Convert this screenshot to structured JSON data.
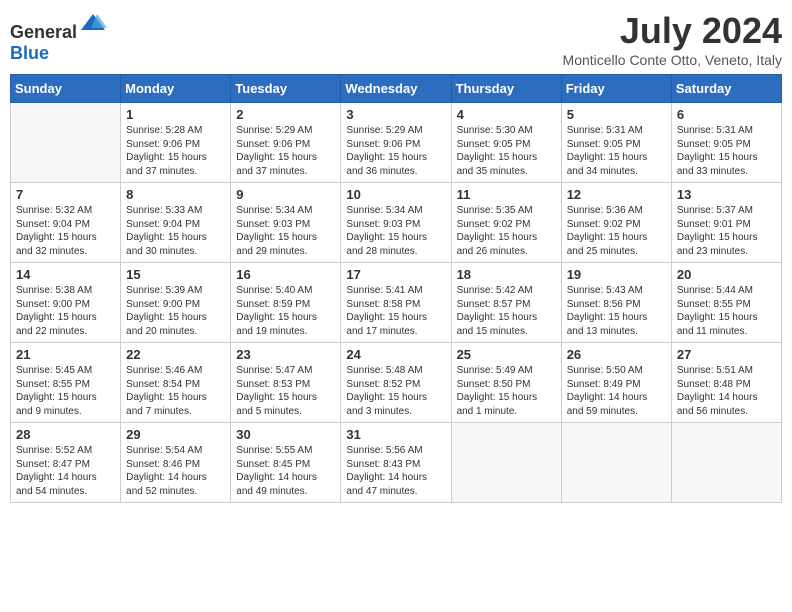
{
  "header": {
    "logo": {
      "general": "General",
      "blue": "Blue"
    },
    "month_year": "July 2024",
    "location": "Monticello Conte Otto, Veneto, Italy"
  },
  "weekdays": [
    "Sunday",
    "Monday",
    "Tuesday",
    "Wednesday",
    "Thursday",
    "Friday",
    "Saturday"
  ],
  "weeks": [
    [
      {
        "day": "",
        "content": ""
      },
      {
        "day": "1",
        "content": "Sunrise: 5:28 AM\nSunset: 9:06 PM\nDaylight: 15 hours\nand 37 minutes."
      },
      {
        "day": "2",
        "content": "Sunrise: 5:29 AM\nSunset: 9:06 PM\nDaylight: 15 hours\nand 37 minutes."
      },
      {
        "day": "3",
        "content": "Sunrise: 5:29 AM\nSunset: 9:06 PM\nDaylight: 15 hours\nand 36 minutes."
      },
      {
        "day": "4",
        "content": "Sunrise: 5:30 AM\nSunset: 9:05 PM\nDaylight: 15 hours\nand 35 minutes."
      },
      {
        "day": "5",
        "content": "Sunrise: 5:31 AM\nSunset: 9:05 PM\nDaylight: 15 hours\nand 34 minutes."
      },
      {
        "day": "6",
        "content": "Sunrise: 5:31 AM\nSunset: 9:05 PM\nDaylight: 15 hours\nand 33 minutes."
      }
    ],
    [
      {
        "day": "7",
        "content": "Sunrise: 5:32 AM\nSunset: 9:04 PM\nDaylight: 15 hours\nand 32 minutes."
      },
      {
        "day": "8",
        "content": "Sunrise: 5:33 AM\nSunset: 9:04 PM\nDaylight: 15 hours\nand 30 minutes."
      },
      {
        "day": "9",
        "content": "Sunrise: 5:34 AM\nSunset: 9:03 PM\nDaylight: 15 hours\nand 29 minutes."
      },
      {
        "day": "10",
        "content": "Sunrise: 5:34 AM\nSunset: 9:03 PM\nDaylight: 15 hours\nand 28 minutes."
      },
      {
        "day": "11",
        "content": "Sunrise: 5:35 AM\nSunset: 9:02 PM\nDaylight: 15 hours\nand 26 minutes."
      },
      {
        "day": "12",
        "content": "Sunrise: 5:36 AM\nSunset: 9:02 PM\nDaylight: 15 hours\nand 25 minutes."
      },
      {
        "day": "13",
        "content": "Sunrise: 5:37 AM\nSunset: 9:01 PM\nDaylight: 15 hours\nand 23 minutes."
      }
    ],
    [
      {
        "day": "14",
        "content": "Sunrise: 5:38 AM\nSunset: 9:00 PM\nDaylight: 15 hours\nand 22 minutes."
      },
      {
        "day": "15",
        "content": "Sunrise: 5:39 AM\nSunset: 9:00 PM\nDaylight: 15 hours\nand 20 minutes."
      },
      {
        "day": "16",
        "content": "Sunrise: 5:40 AM\nSunset: 8:59 PM\nDaylight: 15 hours\nand 19 minutes."
      },
      {
        "day": "17",
        "content": "Sunrise: 5:41 AM\nSunset: 8:58 PM\nDaylight: 15 hours\nand 17 minutes."
      },
      {
        "day": "18",
        "content": "Sunrise: 5:42 AM\nSunset: 8:57 PM\nDaylight: 15 hours\nand 15 minutes."
      },
      {
        "day": "19",
        "content": "Sunrise: 5:43 AM\nSunset: 8:56 PM\nDaylight: 15 hours\nand 13 minutes."
      },
      {
        "day": "20",
        "content": "Sunrise: 5:44 AM\nSunset: 8:55 PM\nDaylight: 15 hours\nand 11 minutes."
      }
    ],
    [
      {
        "day": "21",
        "content": "Sunrise: 5:45 AM\nSunset: 8:55 PM\nDaylight: 15 hours\nand 9 minutes."
      },
      {
        "day": "22",
        "content": "Sunrise: 5:46 AM\nSunset: 8:54 PM\nDaylight: 15 hours\nand 7 minutes."
      },
      {
        "day": "23",
        "content": "Sunrise: 5:47 AM\nSunset: 8:53 PM\nDaylight: 15 hours\nand 5 minutes."
      },
      {
        "day": "24",
        "content": "Sunrise: 5:48 AM\nSunset: 8:52 PM\nDaylight: 15 hours\nand 3 minutes."
      },
      {
        "day": "25",
        "content": "Sunrise: 5:49 AM\nSunset: 8:50 PM\nDaylight: 15 hours\nand 1 minute."
      },
      {
        "day": "26",
        "content": "Sunrise: 5:50 AM\nSunset: 8:49 PM\nDaylight: 14 hours\nand 59 minutes."
      },
      {
        "day": "27",
        "content": "Sunrise: 5:51 AM\nSunset: 8:48 PM\nDaylight: 14 hours\nand 56 minutes."
      }
    ],
    [
      {
        "day": "28",
        "content": "Sunrise: 5:52 AM\nSunset: 8:47 PM\nDaylight: 14 hours\nand 54 minutes."
      },
      {
        "day": "29",
        "content": "Sunrise: 5:54 AM\nSunset: 8:46 PM\nDaylight: 14 hours\nand 52 minutes."
      },
      {
        "day": "30",
        "content": "Sunrise: 5:55 AM\nSunset: 8:45 PM\nDaylight: 14 hours\nand 49 minutes."
      },
      {
        "day": "31",
        "content": "Sunrise: 5:56 AM\nSunset: 8:43 PM\nDaylight: 14 hours\nand 47 minutes."
      },
      {
        "day": "",
        "content": ""
      },
      {
        "day": "",
        "content": ""
      },
      {
        "day": "",
        "content": ""
      }
    ]
  ]
}
